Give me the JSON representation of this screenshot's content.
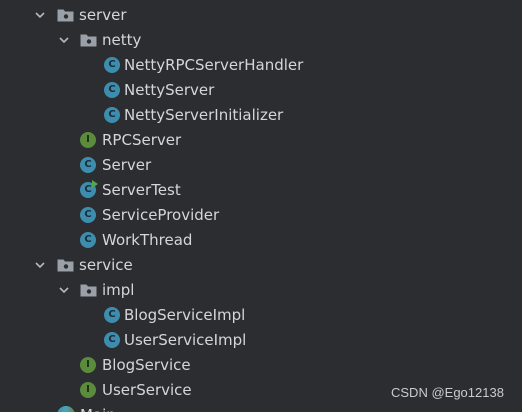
{
  "project_tree": {
    "nodes": [
      {
        "label": "server",
        "kind": "package",
        "expanded": true,
        "depth": 0
      },
      {
        "label": "netty",
        "kind": "package",
        "expanded": true,
        "depth": 1
      },
      {
        "label": "NettyRPCServerHandler",
        "kind": "class",
        "icon": "class-icon",
        "depth": 2
      },
      {
        "label": "NettyServer",
        "kind": "class",
        "icon": "class-icon",
        "depth": 2
      },
      {
        "label": "NettyServerInitializer",
        "kind": "class",
        "icon": "class-icon",
        "depth": 2
      },
      {
        "label": "RPCServer",
        "kind": "interface",
        "icon": "interface-icon",
        "depth": 1
      },
      {
        "label": "Server",
        "kind": "class",
        "icon": "class-icon",
        "depth": 1
      },
      {
        "label": "ServerTest",
        "kind": "runnable-class",
        "icon": "runnable-class-icon",
        "depth": 1
      },
      {
        "label": "ServiceProvider",
        "kind": "class",
        "icon": "class-icon",
        "depth": 1
      },
      {
        "label": "WorkThread",
        "kind": "class",
        "icon": "class-icon",
        "depth": 1
      },
      {
        "label": "service",
        "kind": "package",
        "expanded": true,
        "depth": 0
      },
      {
        "label": "impl",
        "kind": "package",
        "expanded": true,
        "depth": 1
      },
      {
        "label": "BlogServiceImpl",
        "kind": "class",
        "icon": "class-icon",
        "depth": 2
      },
      {
        "label": "UserServiceImpl",
        "kind": "class",
        "icon": "class-icon",
        "depth": 2
      },
      {
        "label": "BlogService",
        "kind": "interface",
        "icon": "interface-icon",
        "depth": 1
      },
      {
        "label": "UserService",
        "kind": "interface",
        "icon": "interface-icon",
        "depth": 1
      }
    ],
    "partial_last_item": {
      "label": "Main",
      "icon": "java-main-icon"
    }
  },
  "icon_letters": {
    "class": "C",
    "interface": "I"
  },
  "colors": {
    "background": "#2b2d30",
    "text": "#d4d6da",
    "class_icon": "#3d8dae",
    "interface_icon": "#5a8c3c",
    "run_badge": "#57a64a"
  },
  "watermark": "CSDN @Ego12138"
}
